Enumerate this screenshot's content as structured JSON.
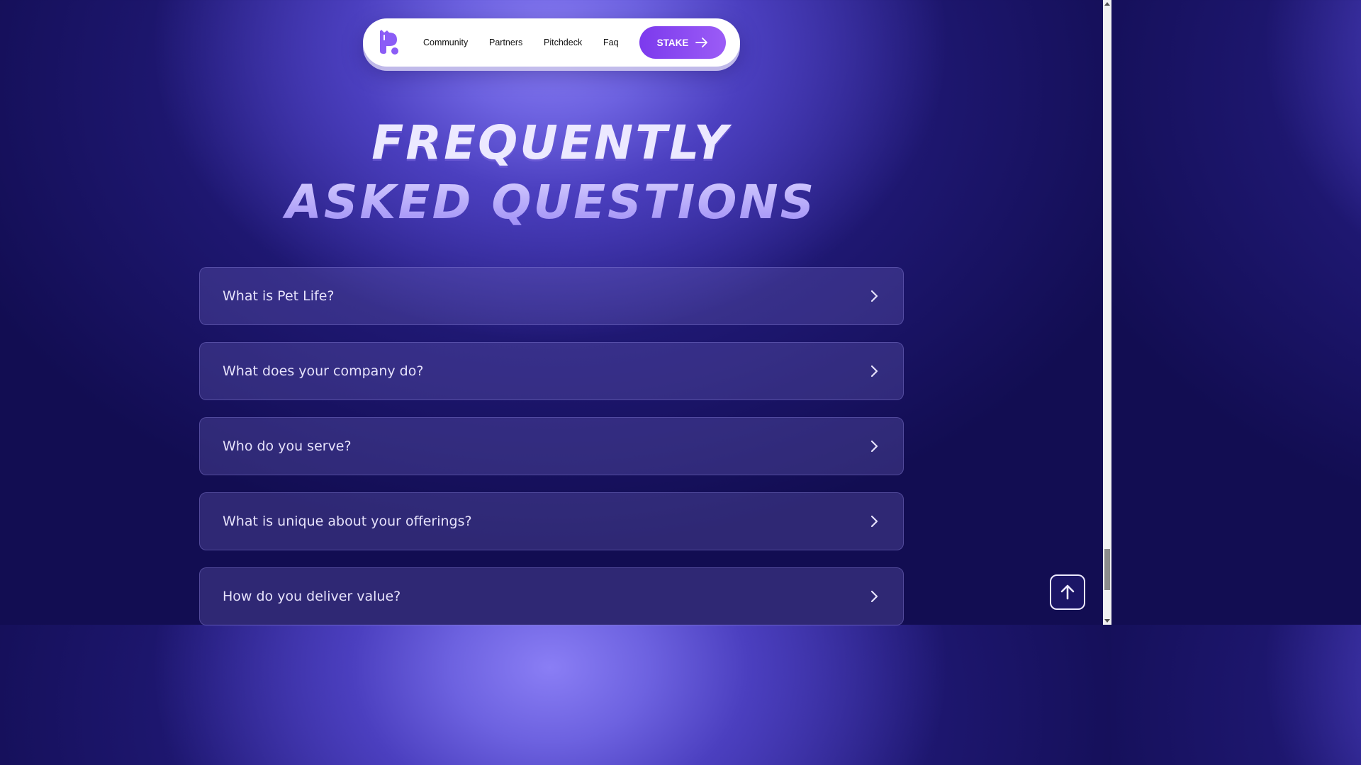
{
  "nav": {
    "links": [
      {
        "label": "Community"
      },
      {
        "label": "Partners"
      },
      {
        "label": "Pitchdeck"
      },
      {
        "label": "Faq"
      }
    ],
    "cta_label": "STAKE",
    "logo_icon": "pet-life-logo-icon"
  },
  "heading": {
    "line1": "Frequently",
    "line2": "Asked Questions"
  },
  "faq": {
    "items": [
      {
        "question": "What is Pet Life?"
      },
      {
        "question": "What does your company do?"
      },
      {
        "question": "Who do you serve?"
      },
      {
        "question": "What is unique about your offerings?"
      },
      {
        "question": "How do you deliver value?"
      }
    ],
    "expand_icon": "chevron-right-icon"
  },
  "back_to_top_icon": "arrow-up-icon",
  "colors": {
    "brand_purple": "#7c3aed",
    "background_dark": "#120d52",
    "heading_light": "#ece9ff",
    "heading_accent": "#b5a8ff"
  }
}
